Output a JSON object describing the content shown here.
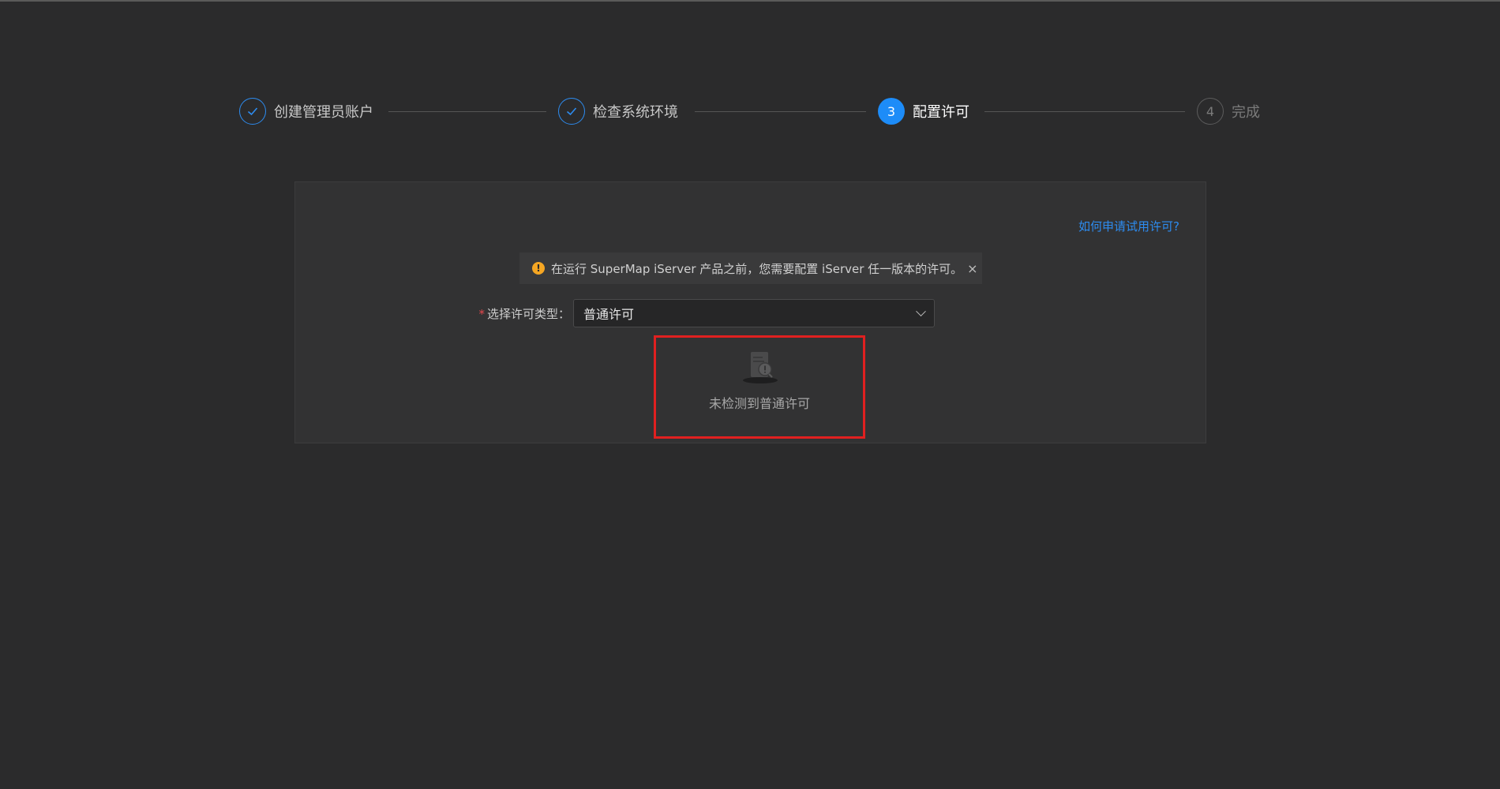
{
  "steps": [
    {
      "label": "创建管理员账户",
      "state": "done",
      "icon": "check-icon"
    },
    {
      "label": "检查系统环境",
      "state": "done",
      "icon": "check-icon"
    },
    {
      "label": "配置许可",
      "state": "active",
      "number": "3"
    },
    {
      "label": "完成",
      "state": "wait",
      "number": "4"
    }
  ],
  "card": {
    "help_link": "如何申请试用许可?",
    "alert": {
      "icon": "warning-icon",
      "text": "在运行 SuperMap iServer 产品之前，您需要配置 iServer 任一版本的许可。",
      "close": "×"
    },
    "form": {
      "required_mark": "*",
      "label": "选择许可类型：",
      "select_value": "普通许可"
    },
    "empty": {
      "icon": "no-license-document-icon",
      "text": "未检测到普通许可"
    }
  },
  "colors": {
    "background": "#2b2b2c",
    "accent": "#2d8cf0",
    "warning": "#f5a623",
    "highlight_border": "#e02020"
  }
}
